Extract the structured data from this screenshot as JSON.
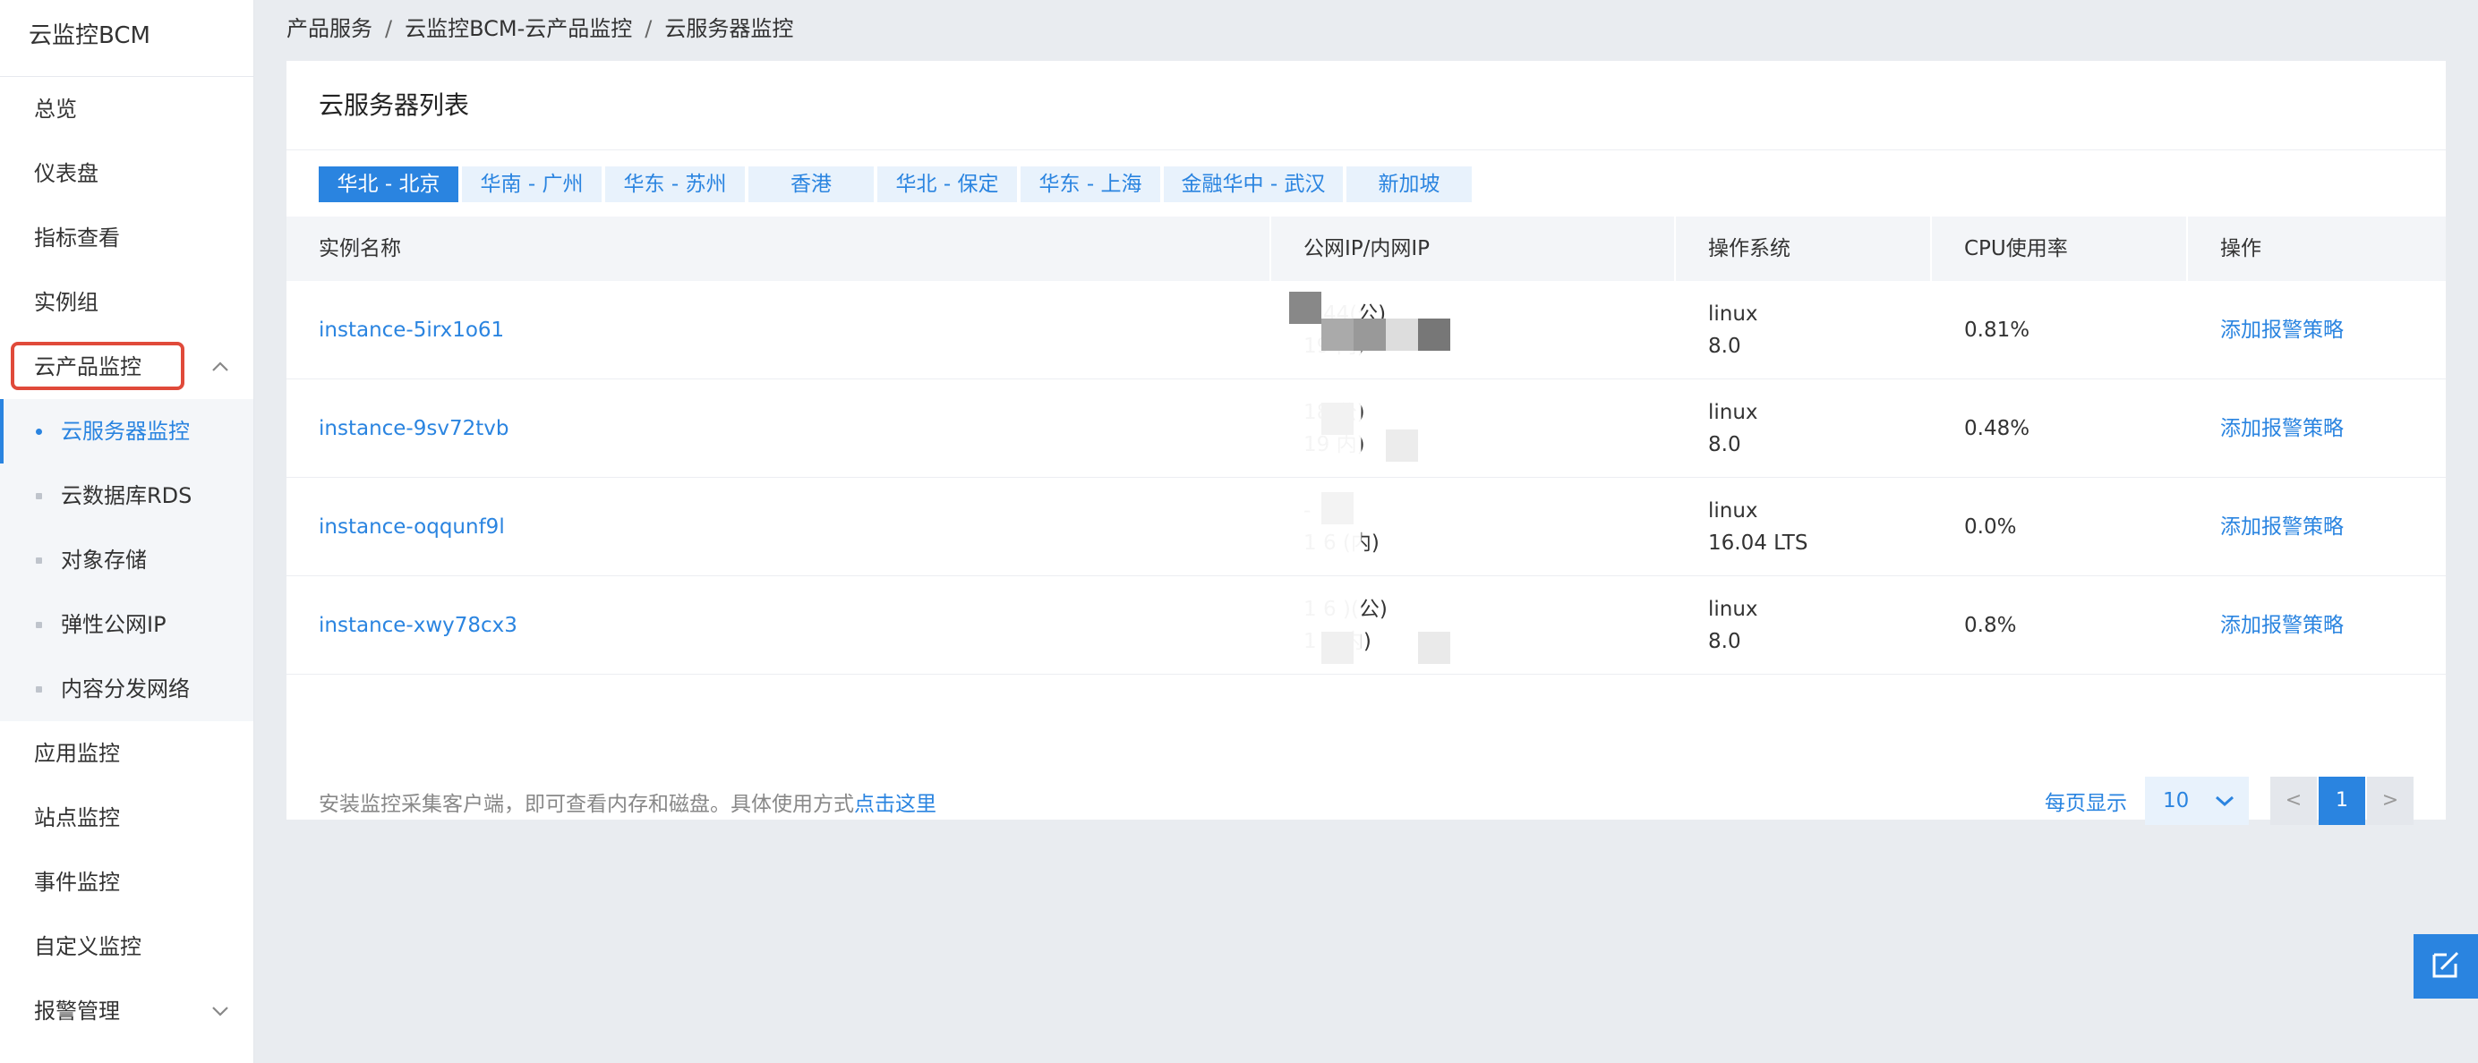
{
  "sidebar": {
    "title": "云监控BCM",
    "items_top": [
      "总览",
      "仪表盘",
      "指标查看",
      "实例组"
    ],
    "group_label": "云产品监控",
    "sub_items": [
      "云服务器监控",
      "云数据库RDS",
      "对象存储",
      "弹性公网IP",
      "内容分发网络"
    ],
    "items_bottom": [
      "应用监控",
      "站点监控",
      "事件监控",
      "自定义监控"
    ],
    "alarm_label": "报警管理"
  },
  "breadcrumb": [
    "产品服务",
    "云监控BCM-云产品监控",
    "云服务器监控"
  ],
  "breadcrumb_sep": "/",
  "panel_title": "云服务器列表",
  "regions": [
    "华北 - 北京",
    "华南 - 广州",
    "华东 - 苏州",
    "香港",
    "华北 - 保定",
    "华东 - 上海",
    "金融华中 - 武汉",
    "新加坡"
  ],
  "table": {
    "headers": [
      "实例名称",
      "公网IP/内网IP",
      "操作系统",
      "CPU使用率",
      "操作"
    ],
    "rows": [
      {
        "name": "instance-5irx1o61",
        "ip1": "1       44(公)",
        "ip2": "19          内)",
        "os1": "linux",
        "os2": "8.0",
        "cpu": "0.81%",
        "action": "添加报警策略"
      },
      {
        "name": "instance-9sv72tvb",
        "ip1": "18           公)",
        "ip2": "19            内)",
        "os1": "linux",
        "os2": "8.0",
        "cpu": "0.48%",
        "action": "添加报警策略"
      },
      {
        "name": "instance-oqqunf9l",
        "ip1": "-",
        "ip2": "1     6           (内)",
        "os1": "linux",
        "os2": "16.04 LTS",
        "cpu": "0.0%",
        "action": "添加报警策略"
      },
      {
        "name": "instance-xwy78cx3",
        "ip1": "1     6          )(公)",
        "ip2": "1     6            内)",
        "os1": "linux",
        "os2": "8.0",
        "cpu": "0.8%",
        "action": "添加报警策略"
      }
    ]
  },
  "footer": {
    "text": "安装监控采集客户端，即可查看内存和磁盘。具体使用方式",
    "link": "点击这里",
    "per_page_label": "每页显示",
    "per_page_value": "10",
    "prev": "<",
    "current_page": "1",
    "next": ">"
  },
  "colors": {
    "accent": "#2a84e0",
    "highlight_border": "#e04a3a",
    "background": "#e9ecf0"
  }
}
